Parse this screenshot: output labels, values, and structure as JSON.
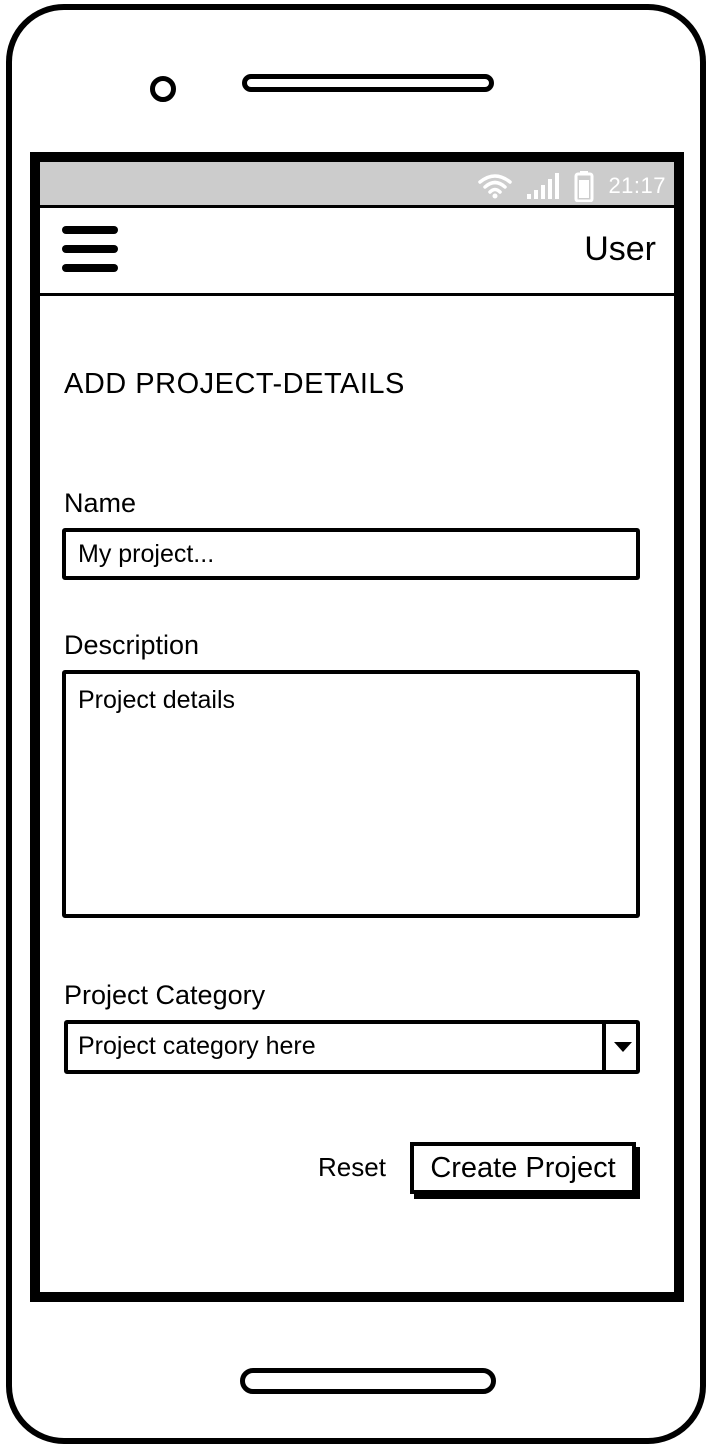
{
  "status_bar": {
    "time": "21:17",
    "icons": [
      "wifi-icon",
      "signal-icon",
      "battery-icon"
    ],
    "background": "#cccccc"
  },
  "app_bar": {
    "menu_icon": "hamburger-icon",
    "user_label": "User"
  },
  "form": {
    "title": "ADD PROJECT-DETAILS",
    "name": {
      "label": "Name",
      "value": "My project..."
    },
    "description": {
      "label": "Description",
      "value": "Project details"
    },
    "category": {
      "label": "Project Category",
      "selected": "Project category here"
    },
    "reset_label": "Reset",
    "submit_label": "Create Project"
  }
}
